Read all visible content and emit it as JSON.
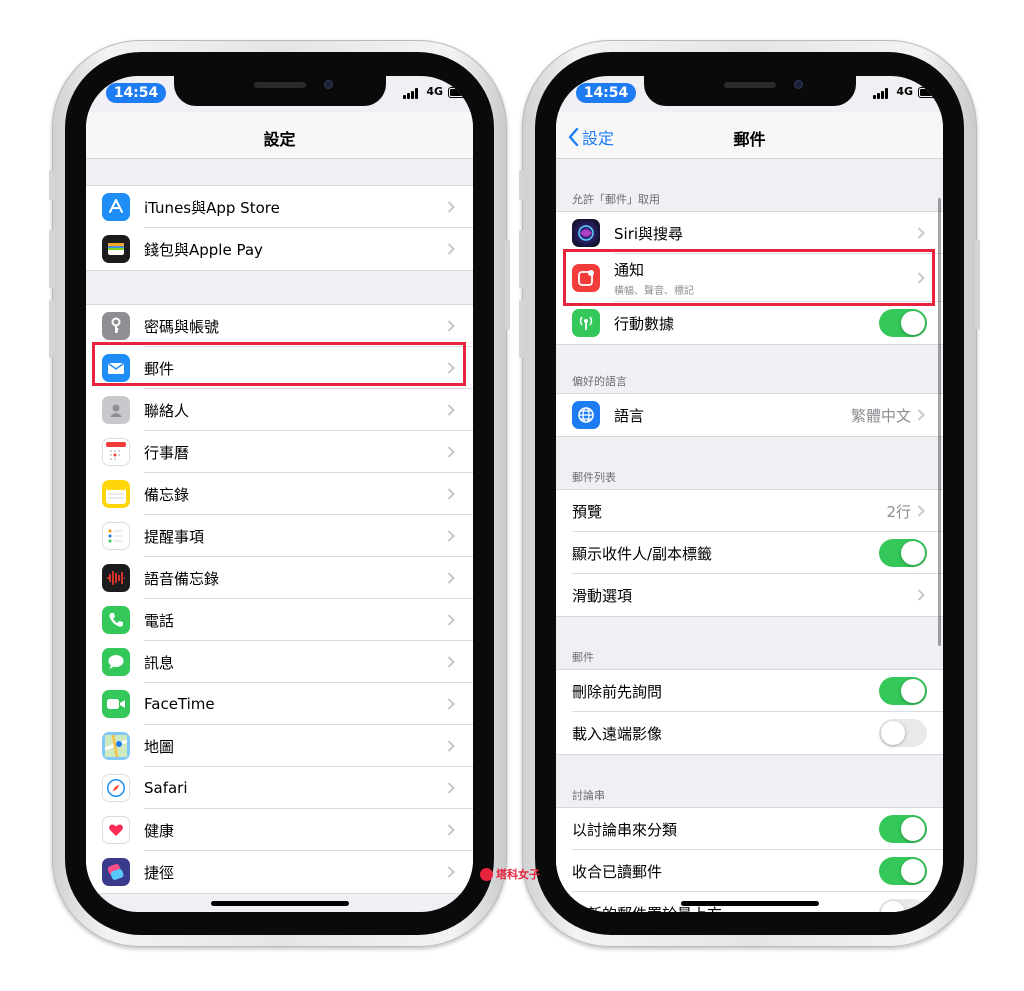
{
  "left_phone": {
    "status": {
      "time": "14:54",
      "network": "4G"
    },
    "nav_title": "設定",
    "group1": [
      {
        "label": "iTunes與App Store",
        "icon": "app-store-icon",
        "color": "#1e8ef6"
      },
      {
        "label": "錢包與Apple Pay",
        "icon": "wallet-icon",
        "color": "#1c1c1e"
      }
    ],
    "group2": [
      {
        "label": "密碼與帳號",
        "icon": "key-icon",
        "color": "#8e8e93"
      },
      {
        "label": "郵件",
        "icon": "mail-icon",
        "color": "#1e8ef6"
      },
      {
        "label": "聯絡人",
        "icon": "contacts-icon",
        "color": "#c7c7cc"
      },
      {
        "label": "行事曆",
        "icon": "calendar-icon",
        "color": "#ffffff"
      },
      {
        "label": "備忘錄",
        "icon": "notes-icon",
        "color": "#ffd60a"
      },
      {
        "label": "提醒事項",
        "icon": "reminders-icon",
        "color": "#ffffff"
      },
      {
        "label": "語音備忘錄",
        "icon": "voice-memos-icon",
        "color": "#1c1c1e"
      },
      {
        "label": "電話",
        "icon": "phone-icon",
        "color": "#34c759"
      },
      {
        "label": "訊息",
        "icon": "messages-icon",
        "color": "#34c759"
      },
      {
        "label": "FaceTime",
        "icon": "facetime-icon",
        "color": "#34c759"
      },
      {
        "label": "地圖",
        "icon": "maps-icon",
        "color": "#7fc8f8"
      },
      {
        "label": "Safari",
        "icon": "safari-icon",
        "color": "#ffffff"
      },
      {
        "label": "健康",
        "icon": "health-icon",
        "color": "#ffffff"
      },
      {
        "label": "捷徑",
        "icon": "shortcuts-icon",
        "color": "#3a3a8c"
      }
    ]
  },
  "right_phone": {
    "status": {
      "time": "14:54",
      "network": "4G"
    },
    "nav_back": "設定",
    "nav_title": "郵件",
    "section_access": {
      "header": "允許「郵件」取用",
      "siri": "Siri與搜尋",
      "notifications": "通知",
      "notifications_sub": "橫幅、聲音、標記",
      "cellular": "行動數據",
      "cellular_on": true
    },
    "section_language": {
      "header": "偏好的語言",
      "language": "語言",
      "language_value": "繁體中文"
    },
    "section_list": {
      "header": "郵件列表",
      "preview": "預覽",
      "preview_value": "2行",
      "show_to_cc": "顯示收件人/副本標籤",
      "swipe": "滑動選項"
    },
    "section_messages": {
      "header": "郵件",
      "ask_before_delete": "刪除前先詢問",
      "load_remote": "載入遠端影像"
    },
    "section_threading": {
      "header": "討論串",
      "organize": "以討論串來分類",
      "collapse_read": "收合已讀郵件",
      "latest_top": "最新的郵件置於最上方"
    }
  },
  "watermark": "塔科女子",
  "colors": {
    "highlight": "#e8233e",
    "accent": "#1e7cf2",
    "toggle_on": "#34c759"
  }
}
